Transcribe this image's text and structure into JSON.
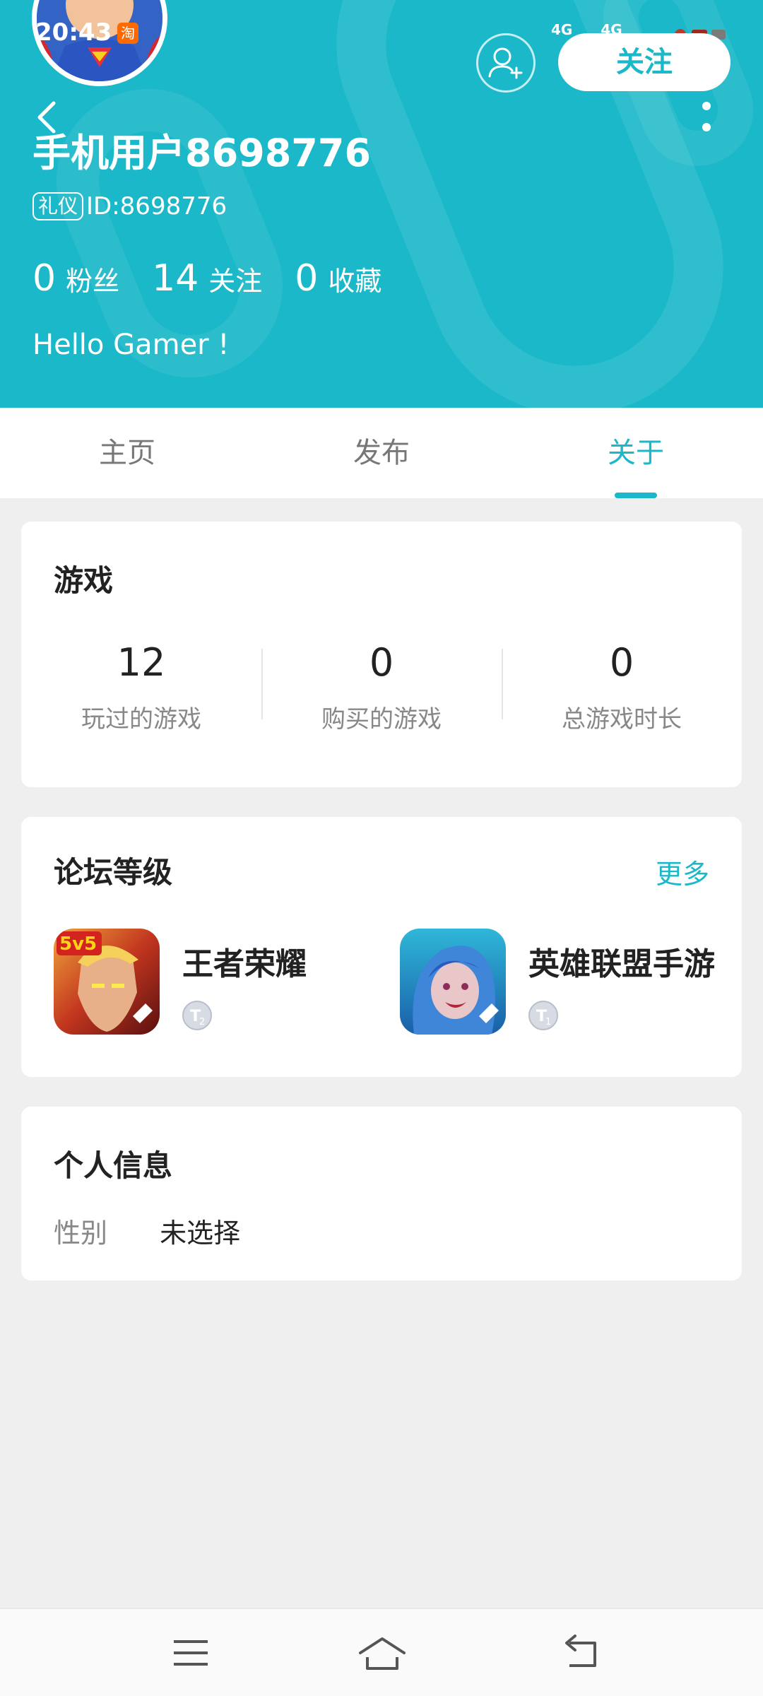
{
  "status_bar": {
    "time": "20:43",
    "app_badge": "淘",
    "signal_1": "4G",
    "signal_2": "4G"
  },
  "profile": {
    "username": "手机用户8698776",
    "id_badge": "礼仪",
    "id_text": "ID:8698776",
    "followers_count": "0",
    "followers_label": "粉丝",
    "following_count": "14",
    "following_label": "关注",
    "favorites_count": "0",
    "favorites_label": "收藏",
    "bio": "Hello Gamer !",
    "follow_button": "关注"
  },
  "tabs": [
    {
      "label": "主页",
      "active": false
    },
    {
      "label": "发布",
      "active": false
    },
    {
      "label": "关于",
      "active": true
    }
  ],
  "games_card": {
    "title": "游戏",
    "stats": [
      {
        "value": "12",
        "label": "玩过的游戏"
      },
      {
        "value": "0",
        "label": "购买的游戏"
      },
      {
        "value": "0",
        "label": "总游戏时长"
      }
    ]
  },
  "forum_card": {
    "title": "论坛等级",
    "more_label": "更多",
    "items": [
      {
        "name": "王者荣耀",
        "icon": "honor-of-kings-icon",
        "level_icon": "level-t2-badge"
      },
      {
        "name": "英雄联盟手游",
        "icon": "lol-mobile-icon",
        "level_icon": "level-t1-badge"
      }
    ]
  },
  "info_card": {
    "title": "个人信息",
    "gender_label": "性别",
    "gender_value": "未选择"
  },
  "colors": {
    "accent": "#1bb8c9",
    "background": "#efefef"
  }
}
